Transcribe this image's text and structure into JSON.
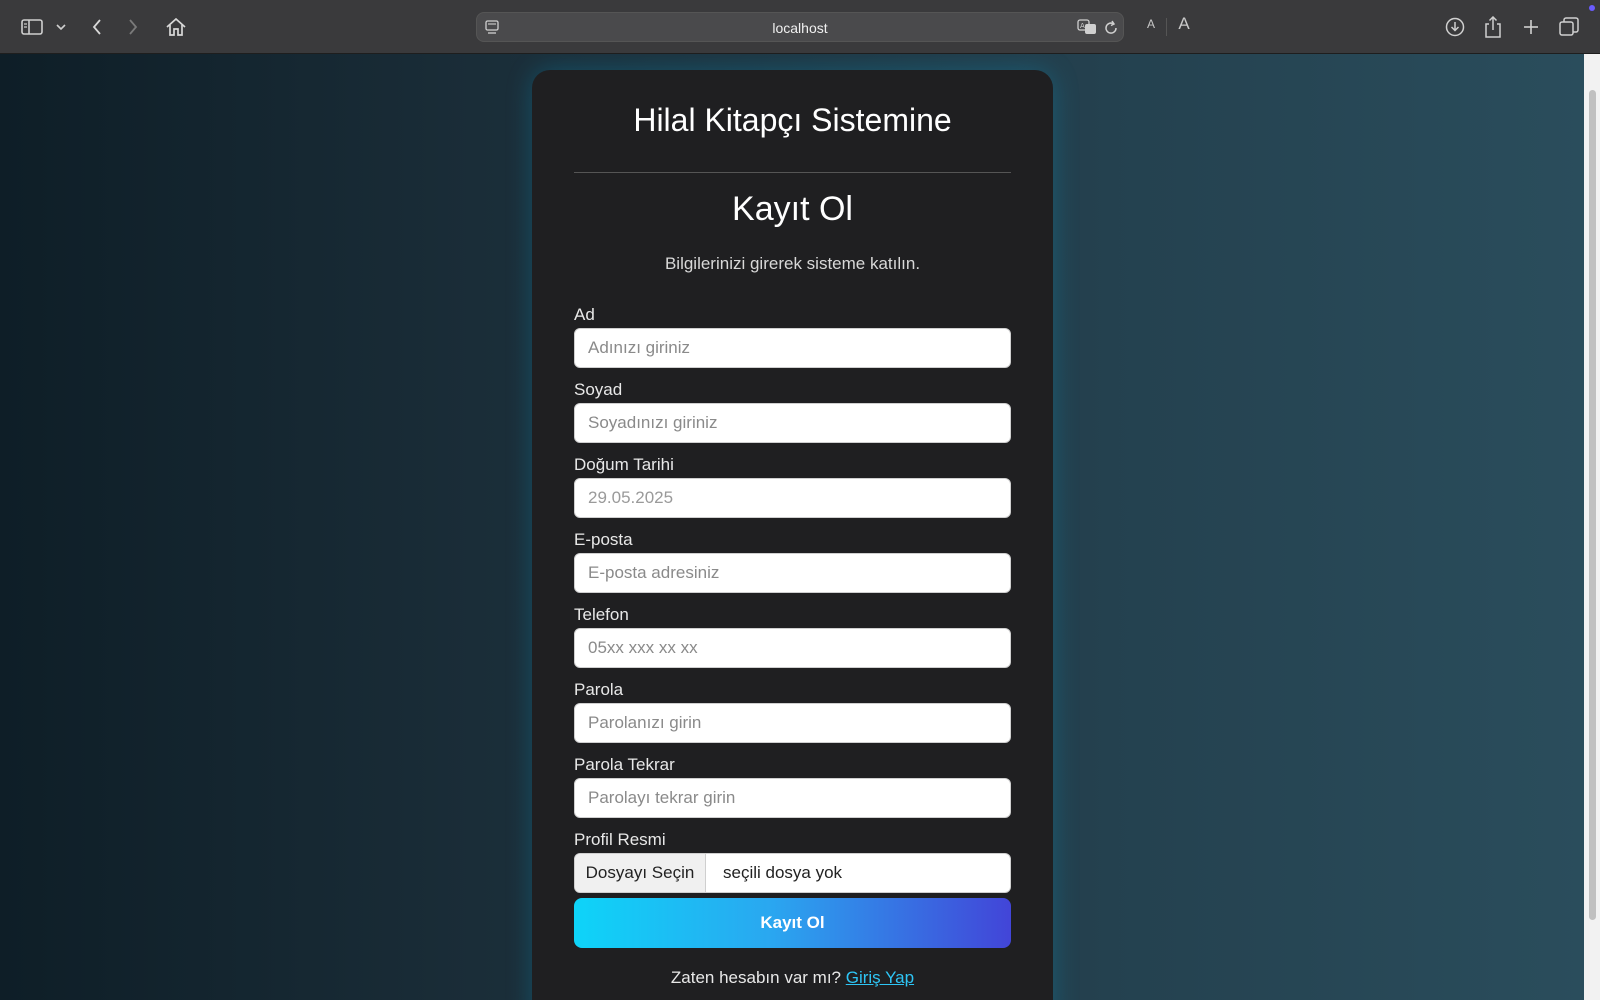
{
  "browser": {
    "url": "localhost",
    "font_small_label": "A",
    "font_large_label": "A",
    "icons": [
      "sidebar-icon",
      "chevron-down-icon",
      "back-icon",
      "forward-icon",
      "home-icon",
      "site-info-icon",
      "translate-icon",
      "reload-icon",
      "download-icon",
      "share-icon",
      "new-tab-icon",
      "tab-overview-icon"
    ]
  },
  "form": {
    "title": "Hilal Kitapçı Sistemine",
    "heading": "Kayıt Ol",
    "description": "Bilgilerinizi girerek sisteme katılın.",
    "fields": {
      "first_name": {
        "label": "Ad",
        "placeholder": "Adınızı giriniz"
      },
      "last_name": {
        "label": "Soyad",
        "placeholder": "Soyadınızı giriniz"
      },
      "birth_date": {
        "label": "Doğum Tarihi",
        "value": "29.05.2025"
      },
      "email": {
        "label": "E-posta",
        "placeholder": "E-posta adresiniz"
      },
      "phone": {
        "label": "Telefon",
        "placeholder": "05xx xxx xx xx"
      },
      "password": {
        "label": "Parola",
        "placeholder": "Parolanızı girin"
      },
      "password_confirm": {
        "label": "Parola Tekrar",
        "placeholder": "Parolayı tekrar girin"
      },
      "profile_image": {
        "label": "Profil Resmi",
        "button": "Dosyayı Seçin",
        "status": "seçili dosya yok"
      }
    },
    "submit_label": "Kayıt Ol",
    "login_prompt": "Zaten hesabın var mı?",
    "login_link": "Giriş Yap"
  },
  "colors": {
    "card_bg": "#1f1f21",
    "button_gradient_start": "#0ed4f8",
    "button_gradient_end": "#4245d8",
    "link": "#2ec5f5"
  }
}
